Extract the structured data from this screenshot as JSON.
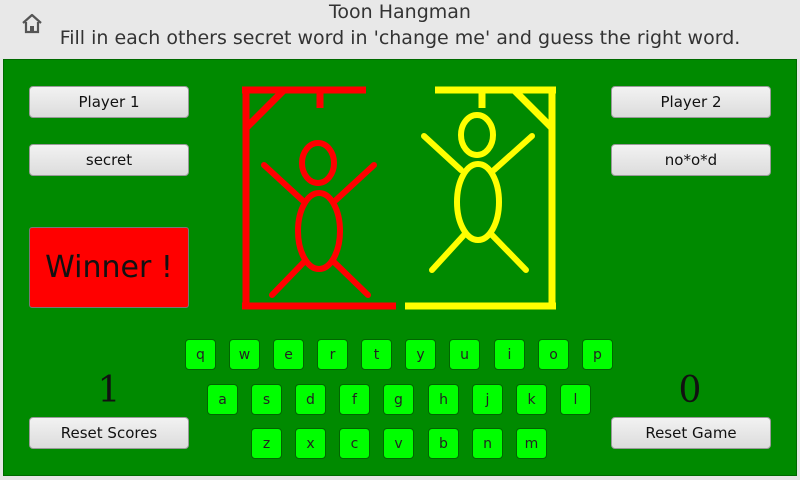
{
  "header": {
    "title": "Toon Hangman",
    "subtitle": "Fill in each others secret word in 'change me' and guess the right word."
  },
  "player1": {
    "name_button": "Player 1",
    "word_button": "secret",
    "score": "1",
    "reset_scores_button": "Reset Scores",
    "color": "#ff0000"
  },
  "player2": {
    "name_button": "Player 2",
    "word_button": "no*o*d",
    "score": "0",
    "reset_game_button": "Reset Game",
    "color": "#ffff00"
  },
  "winner_label": "Winner !",
  "keyboard": {
    "row1": [
      "q",
      "w",
      "e",
      "r",
      "t",
      "y",
      "u",
      "i",
      "o",
      "p"
    ],
    "row2": [
      "a",
      "s",
      "d",
      "f",
      "g",
      "h",
      "j",
      "k",
      "l"
    ],
    "row3": [
      "z",
      "x",
      "c",
      "v",
      "b",
      "n",
      "m"
    ]
  },
  "colors": {
    "board": "#008a00",
    "key": "#00ff00",
    "winner_bg": "#ff0000"
  }
}
